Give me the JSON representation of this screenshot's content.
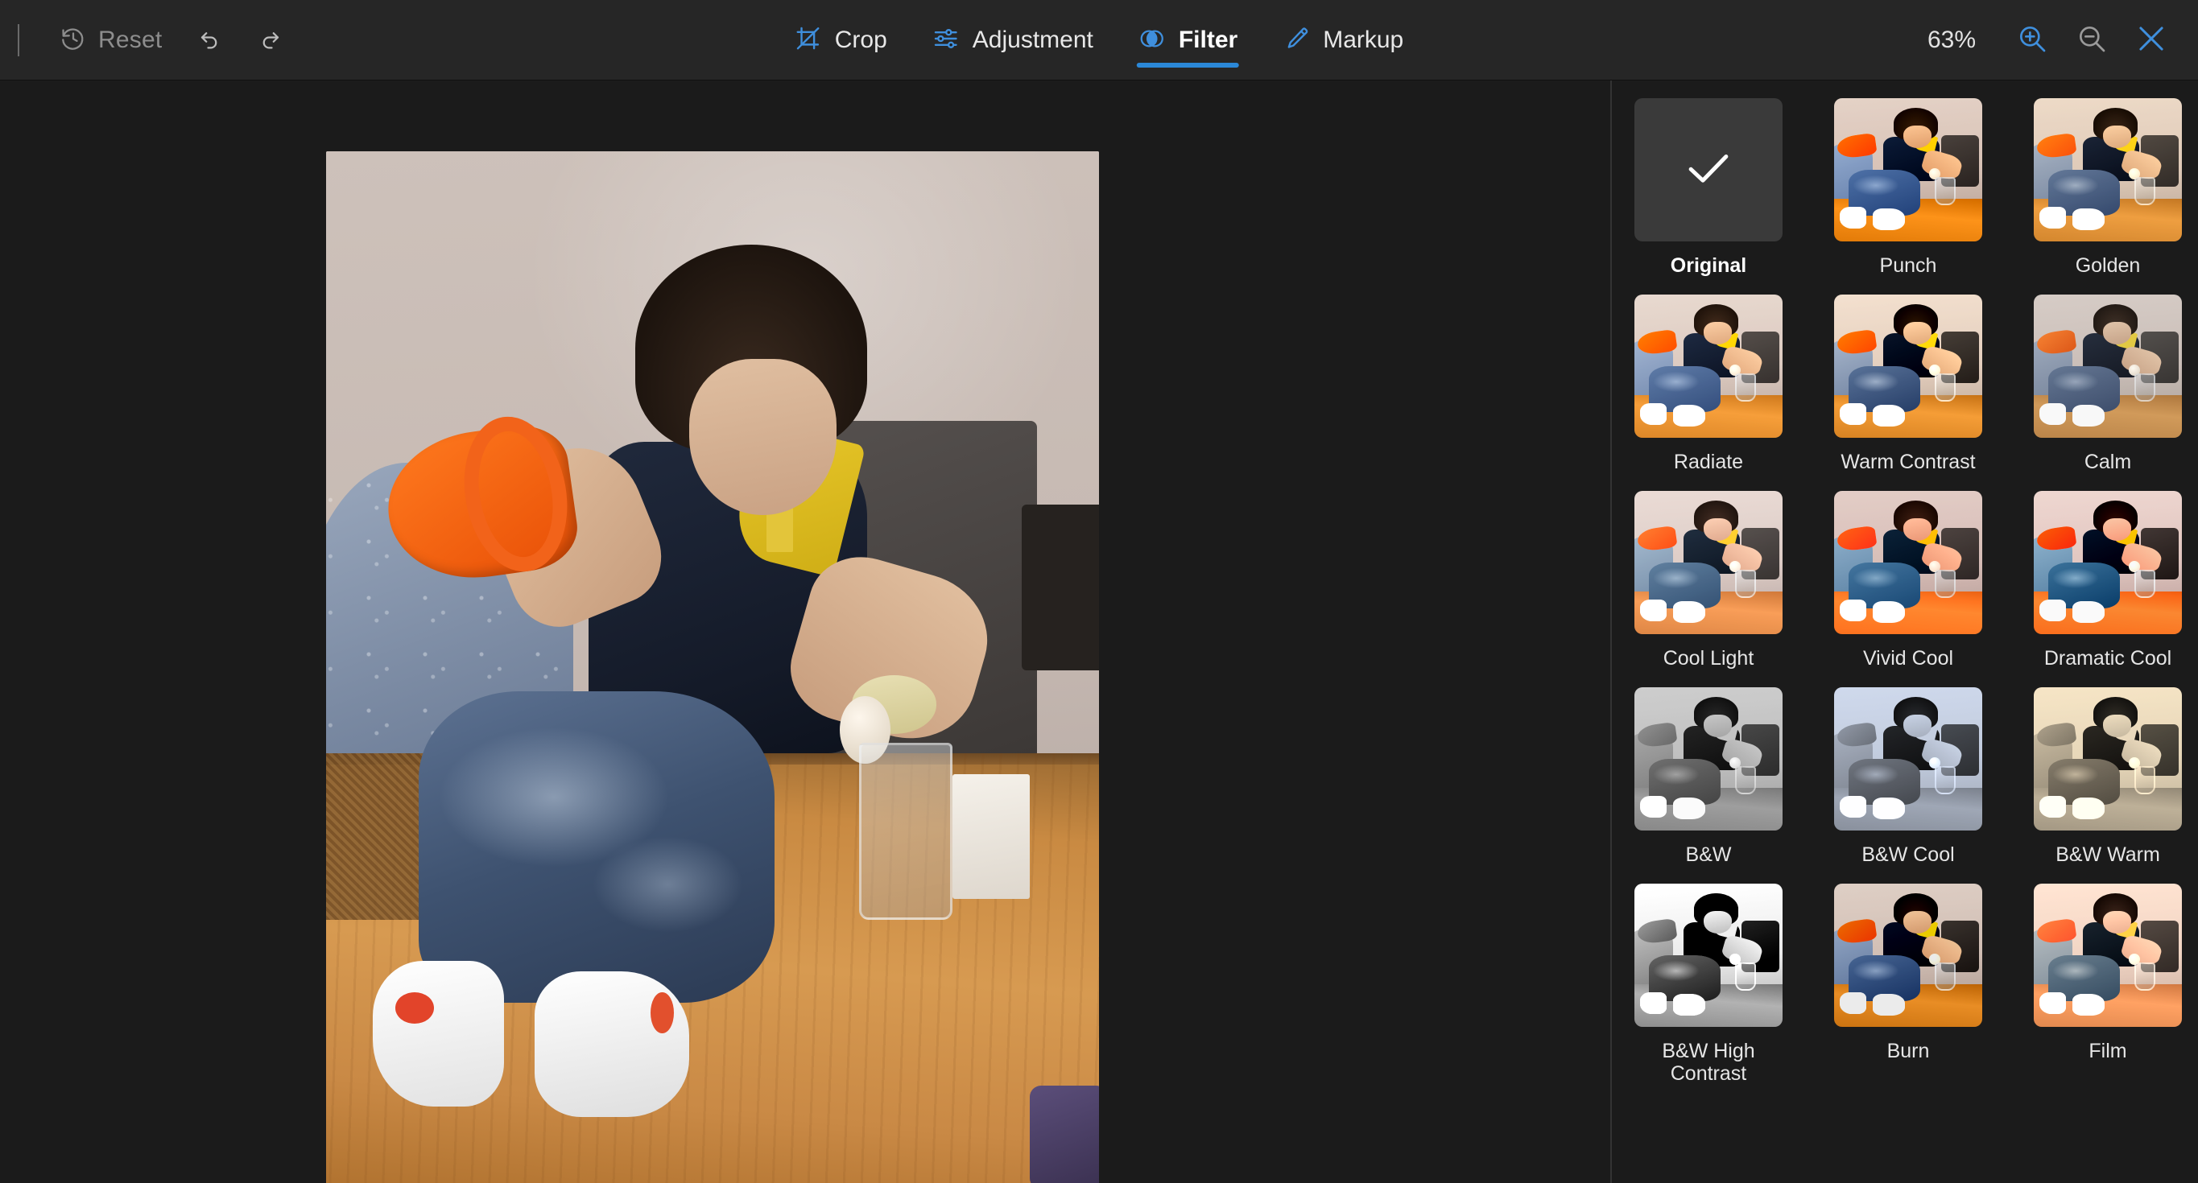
{
  "toolbar": {
    "reset_label": "Reset",
    "undo_icon": "undo-icon",
    "redo_icon": "redo-icon",
    "history_icon": "history-reset-icon",
    "tabs": [
      {
        "label": "Crop",
        "icon": "crop-icon",
        "active": false
      },
      {
        "label": "Adjustment",
        "icon": "sliders-icon",
        "active": false
      },
      {
        "label": "Filter",
        "icon": "filter-circles-icon",
        "active": true
      },
      {
        "label": "Markup",
        "icon": "pen-brush-icon",
        "active": false
      }
    ],
    "zoom_level": "63%",
    "zoom_in_icon": "zoom-in-icon",
    "zoom_out_icon": "zoom-out-icon",
    "close_icon": "close-icon",
    "accent_color": "#2b88d8",
    "inactive_color": "#8d8d8d",
    "background": "#262626"
  },
  "canvas": {
    "background": "#1b1b1b",
    "image_alt": "Toddler in navy polo shirt sitting on wooden table holding an orange toy"
  },
  "filter_panel": {
    "background": "#1b1b1b",
    "selected": "Original",
    "filters": [
      {
        "label": "Original",
        "selected": true,
        "style": "original"
      },
      {
        "label": "Punch",
        "selected": false,
        "style": "punch"
      },
      {
        "label": "Golden",
        "selected": false,
        "style": "golden"
      },
      {
        "label": "Radiate",
        "selected": false,
        "style": "radiate"
      },
      {
        "label": "Warm Contrast",
        "selected": false,
        "style": "warm-contrast"
      },
      {
        "label": "Calm",
        "selected": false,
        "style": "calm"
      },
      {
        "label": "Cool Light",
        "selected": false,
        "style": "cool-light"
      },
      {
        "label": "Vivid Cool",
        "selected": false,
        "style": "vivid-cool"
      },
      {
        "label": "Dramatic Cool",
        "selected": false,
        "style": "dramatic-cool"
      },
      {
        "label": "B&W",
        "selected": false,
        "style": "bw"
      },
      {
        "label": "B&W Cool",
        "selected": false,
        "style": "bw-cool"
      },
      {
        "label": "B&W Warm",
        "selected": false,
        "style": "bw-warm"
      },
      {
        "label": "B&W High Contrast",
        "selected": false,
        "style": "bw-high-contrast"
      },
      {
        "label": "Burn",
        "selected": false,
        "style": "burn"
      },
      {
        "label": "Film",
        "selected": false,
        "style": "film"
      }
    ]
  }
}
